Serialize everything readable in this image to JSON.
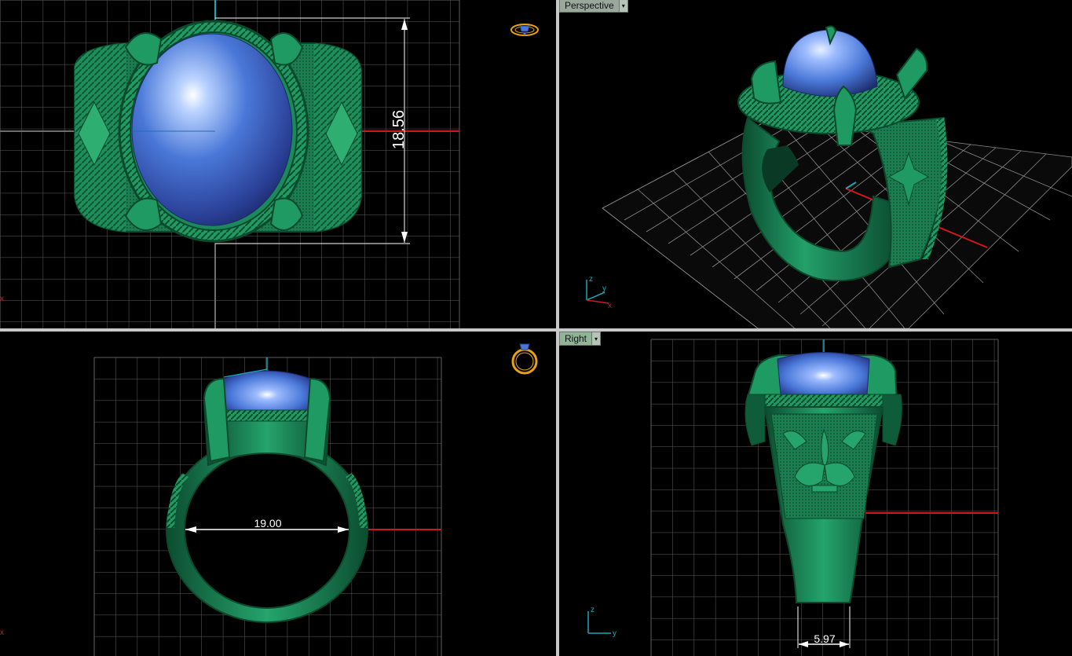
{
  "viewports": {
    "top": {
      "dimension": "18.56",
      "axis_x": "x"
    },
    "perspective": {
      "label": "Perspective",
      "dropdown_icon": "chevron-down-icon",
      "axis_z": "z",
      "axis_y": "y",
      "axis_x": "x"
    },
    "front": {
      "dimension": "19.00",
      "axis_x": "x"
    },
    "right": {
      "label": "Right",
      "dropdown_icon": "chevron-down-icon",
      "dimension": "5.97",
      "axis_z": "z",
      "axis_y": "y"
    }
  },
  "colors": {
    "grid": "#5e5e5e",
    "grid_minor": "#3a3a3a",
    "ring_green": "#1a8a5a",
    "stone_blue": "#4a78d8",
    "axis_red": "#d01818",
    "axis_cyan": "#18a8b8"
  }
}
